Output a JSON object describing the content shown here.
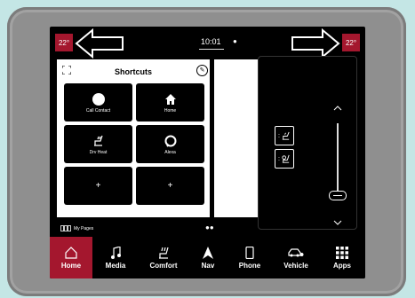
{
  "status_bar": {
    "temp_left": "22°",
    "temp_right": "22°",
    "clock": "10:01"
  },
  "shortcuts": {
    "title": "Shortcuts",
    "tiles": [
      {
        "label": "Call Contact",
        "icon": "person-icon"
      },
      {
        "label": "Home",
        "icon": "home-icon"
      },
      {
        "label": "Drv Heat",
        "icon": "seat-heat-icon"
      },
      {
        "label": "Alexa",
        "icon": "alexa-icon"
      },
      {
        "label": "+",
        "icon": "add-icon"
      },
      {
        "label": "+",
        "icon": "add-icon"
      }
    ]
  },
  "pager": {
    "my_pages_label": "My Pages",
    "dots": "●●"
  },
  "climate_popup": {
    "seat_button_1": ":",
    "seat_button_2": ":",
    "fan_level": 0.1
  },
  "nav": {
    "items": [
      {
        "label": "Home",
        "active": true
      },
      {
        "label": "Media",
        "active": false
      },
      {
        "label": "Comfort",
        "active": false
      },
      {
        "label": "Nav",
        "active": false
      },
      {
        "label": "Phone",
        "active": false
      },
      {
        "label": "Vehicle",
        "active": false
      },
      {
        "label": "Apps",
        "active": false
      }
    ]
  },
  "colors": {
    "accent": "#a4172e",
    "background": "#c4e6e5",
    "bezel": "#8f8f8f"
  }
}
